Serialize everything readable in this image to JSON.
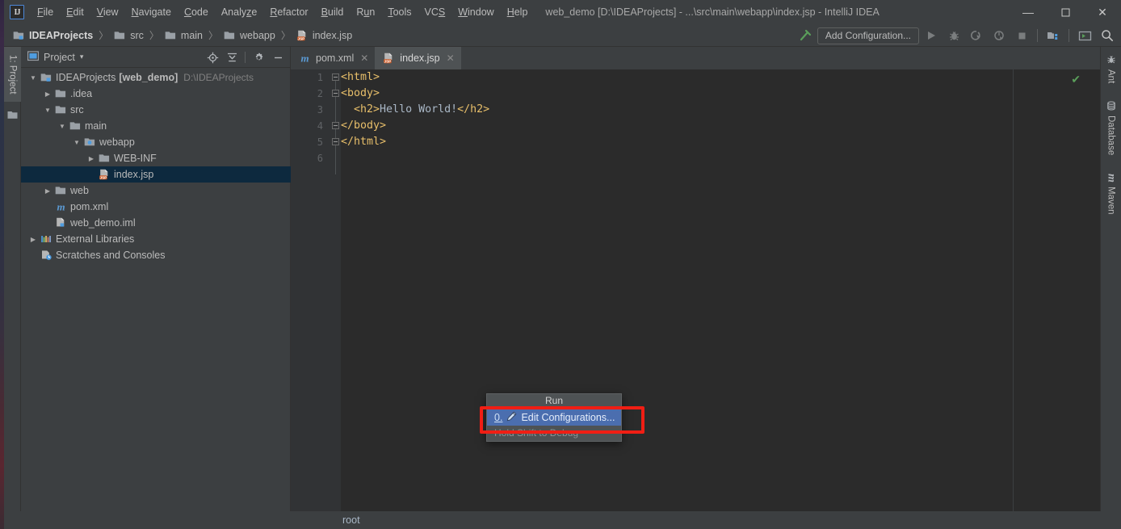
{
  "window": {
    "title": "web_demo [D:\\IDEAProjects] - ...\\src\\main\\webapp\\index.jsp - IntelliJ IDEA",
    "logo": "IJ",
    "minimize": "—",
    "maximize": "☐",
    "close": "✕"
  },
  "menubar": {
    "items": [
      {
        "label": "File",
        "mnemonic": "F"
      },
      {
        "label": "Edit",
        "mnemonic": "E"
      },
      {
        "label": "View",
        "mnemonic": "V"
      },
      {
        "label": "Navigate",
        "mnemonic": "N"
      },
      {
        "label": "Code",
        "mnemonic": "C"
      },
      {
        "label": "Analyze",
        "mnemonic": "z"
      },
      {
        "label": "Refactor",
        "mnemonic": "R"
      },
      {
        "label": "Build",
        "mnemonic": "B"
      },
      {
        "label": "Run",
        "mnemonic": "u"
      },
      {
        "label": "Tools",
        "mnemonic": "T"
      },
      {
        "label": "VCS",
        "mnemonic": "S"
      },
      {
        "label": "Window",
        "mnemonic": "W"
      },
      {
        "label": "Help",
        "mnemonic": "H"
      }
    ]
  },
  "navbar": {
    "crumbs": [
      {
        "label": "IDEAProjects",
        "icon": "module-icon",
        "active": true
      },
      {
        "label": "src",
        "icon": "folder-icon",
        "active": false
      },
      {
        "label": "main",
        "icon": "folder-icon",
        "active": false
      },
      {
        "label": "webapp",
        "icon": "folder-icon",
        "active": false
      },
      {
        "label": "index.jsp",
        "icon": "jsp-file-icon",
        "active": false
      }
    ],
    "separator": "〉",
    "add_configuration": "Add Configuration...",
    "toolbar_icons": [
      "build-hammer-icon",
      "run-icon",
      "debug-icon",
      "run-with-coverage-icon",
      "profiler-icon",
      "stop-icon",
      "project-structure-icon",
      "update-project-icon",
      "search-everywhere-icon"
    ]
  },
  "left_strip": {
    "tab_label": "1: Project",
    "bottom_icon": "folder-icon"
  },
  "project_panel": {
    "title": "Project",
    "title_icon": "project-view-icon",
    "caret": "▾",
    "tools": [
      "locate-target-icon",
      "collapse-all-icon",
      "settings-gear-icon",
      "hide-panel-icon"
    ],
    "tree": [
      {
        "depth": 0,
        "twist": "▼",
        "icon": "module-icon",
        "label": "IDEAProjects",
        "bold_label": "[web_demo]",
        "path": "D:\\IDEAProjects",
        "selected": false
      },
      {
        "depth": 1,
        "twist": "▶",
        "icon": "folder-icon",
        "label": ".idea",
        "selected": false
      },
      {
        "depth": 1,
        "twist": "▼",
        "icon": "folder-icon",
        "label": "src",
        "selected": false
      },
      {
        "depth": 2,
        "twist": "▼",
        "icon": "folder-icon",
        "label": "main",
        "selected": false
      },
      {
        "depth": 3,
        "twist": "▼",
        "icon": "webapp-folder-icon",
        "label": "webapp",
        "selected": false
      },
      {
        "depth": 4,
        "twist": "▶",
        "icon": "folder-icon",
        "label": "WEB-INF",
        "selected": false
      },
      {
        "depth": 4,
        "twist": "",
        "icon": "jsp-file-icon",
        "label": "index.jsp",
        "selected": true
      },
      {
        "depth": 1,
        "twist": "▶",
        "icon": "folder-icon",
        "label": "web",
        "selected": false
      },
      {
        "depth": 1,
        "twist": "",
        "icon": "maven-pom-icon",
        "label": "pom.xml",
        "selected": false
      },
      {
        "depth": 1,
        "twist": "",
        "icon": "iml-file-icon",
        "label": "web_demo.iml",
        "selected": false
      },
      {
        "depth": 0,
        "twist": "▶",
        "icon": "external-libraries-icon",
        "label": "External Libraries",
        "selected": false
      },
      {
        "depth": 0,
        "twist": "",
        "icon": "scratches-icon",
        "label": "Scratches and Consoles",
        "selected": false
      }
    ]
  },
  "editor": {
    "tabs": [
      {
        "label": "pom.xml",
        "icon": "maven-pom-icon",
        "active": false,
        "close": "✕"
      },
      {
        "label": "index.jsp",
        "icon": "jsp-file-icon",
        "active": true,
        "close": "✕"
      }
    ],
    "line_numbers": [
      "1",
      "2",
      "3",
      "4",
      "5",
      "6"
    ],
    "code_lines": [
      {
        "number": "1",
        "segments": [
          {
            "text": "<html>",
            "kind": "tag"
          }
        ],
        "fold": true
      },
      {
        "number": "2",
        "segments": [
          {
            "text": "<body>",
            "kind": "tag"
          }
        ],
        "fold": true
      },
      {
        "number": "3",
        "segments": [
          {
            "text": "  <h2>",
            "kind": "tag"
          },
          {
            "text": "Hello World!",
            "kind": "text"
          },
          {
            "text": "</h2>",
            "kind": "tag"
          }
        ],
        "fold": false
      },
      {
        "number": "4",
        "segments": [
          {
            "text": "</body>",
            "kind": "tag"
          }
        ],
        "fold": true
      },
      {
        "number": "5",
        "segments": [
          {
            "text": "</html>",
            "kind": "tag"
          }
        ],
        "fold": true
      },
      {
        "number": "6",
        "segments": [
          {
            "text": "",
            "kind": "text"
          }
        ],
        "fold": false
      }
    ],
    "inspection_status": "✔"
  },
  "run_popup": {
    "title": "Run",
    "item_mnemonic": "0.",
    "item_icon": "edit-pencil-icon",
    "item_label": "Edit Configurations...",
    "footer": "Hold Shift to Debug"
  },
  "annotation": {
    "shape": "rectangle",
    "color": "#f01e14"
  },
  "right_strip": {
    "tabs": [
      {
        "label": "Ant",
        "icon": "ant-icon"
      },
      {
        "label": "Database",
        "icon": "database-icon"
      },
      {
        "label": "Maven",
        "icon": "maven-icon"
      }
    ]
  },
  "bottom_bar": {
    "breadcrumb": "root"
  },
  "colors": {
    "panel_bg": "#3c3f41",
    "editor_bg": "#2b2b2b",
    "selection_blue": "#0d293e",
    "popup_highlight": "#4b6eaf",
    "tag_orange": "#e8bf6a",
    "accent_red": "#f01e14",
    "status_green": "#5a9e5a"
  }
}
